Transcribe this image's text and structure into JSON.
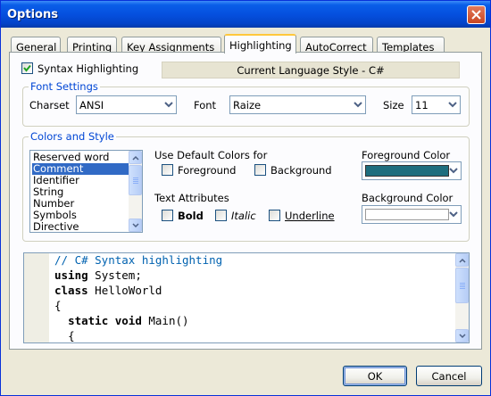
{
  "window": {
    "title": "Options"
  },
  "tabs": [
    {
      "label": "General"
    },
    {
      "label": "Printing"
    },
    {
      "label": "Key Assignments"
    },
    {
      "label": "Highlighting"
    },
    {
      "label": "AutoCorrect"
    },
    {
      "label": "Templates"
    }
  ],
  "active_tab": "Highlighting",
  "syntax_highlighting": {
    "label": "Syntax Highlighting",
    "checked": true
  },
  "current_language": "Current Language Style - C#",
  "font_settings": {
    "title": "Font Settings",
    "charset_label": "Charset",
    "charset_value": "ANSI",
    "font_label": "Font",
    "font_value": "Raize",
    "size_label": "Size",
    "size_value": "11"
  },
  "colors_style": {
    "title": "Colors and Style",
    "elements": [
      "Reserved word",
      "Comment",
      "Identifier",
      "String",
      "Number",
      "Symbols",
      "Directive"
    ],
    "selected_element": "Comment",
    "use_default_label": "Use Default Colors for",
    "foreground_check": "Foreground",
    "background_check": "Background",
    "text_attributes_label": "Text Attributes",
    "bold": "Bold",
    "italic": "Italic",
    "underline": "Underline",
    "foreground_color_label": "Foreground Color",
    "foreground_color": "#1e6e7e",
    "background_color_label": "Background Color",
    "background_color": "#ffffff"
  },
  "preview": {
    "comment": "// C# Syntax highlighting",
    "line2_kw": "using",
    "line2_rest": " System;",
    "line3_kw": "class",
    "line3_rest": " HelloWorld",
    "line4": "{",
    "line5_kw1": "static",
    "line5_kw2": "void",
    "line5_rest": " Main()",
    "line6": "{"
  },
  "buttons": {
    "ok": "OK",
    "cancel": "Cancel"
  },
  "colors": {
    "title_bar": "#0550df",
    "selection": "#316ac5",
    "comment_text": "#0062b0",
    "group_title": "#0046d5"
  }
}
